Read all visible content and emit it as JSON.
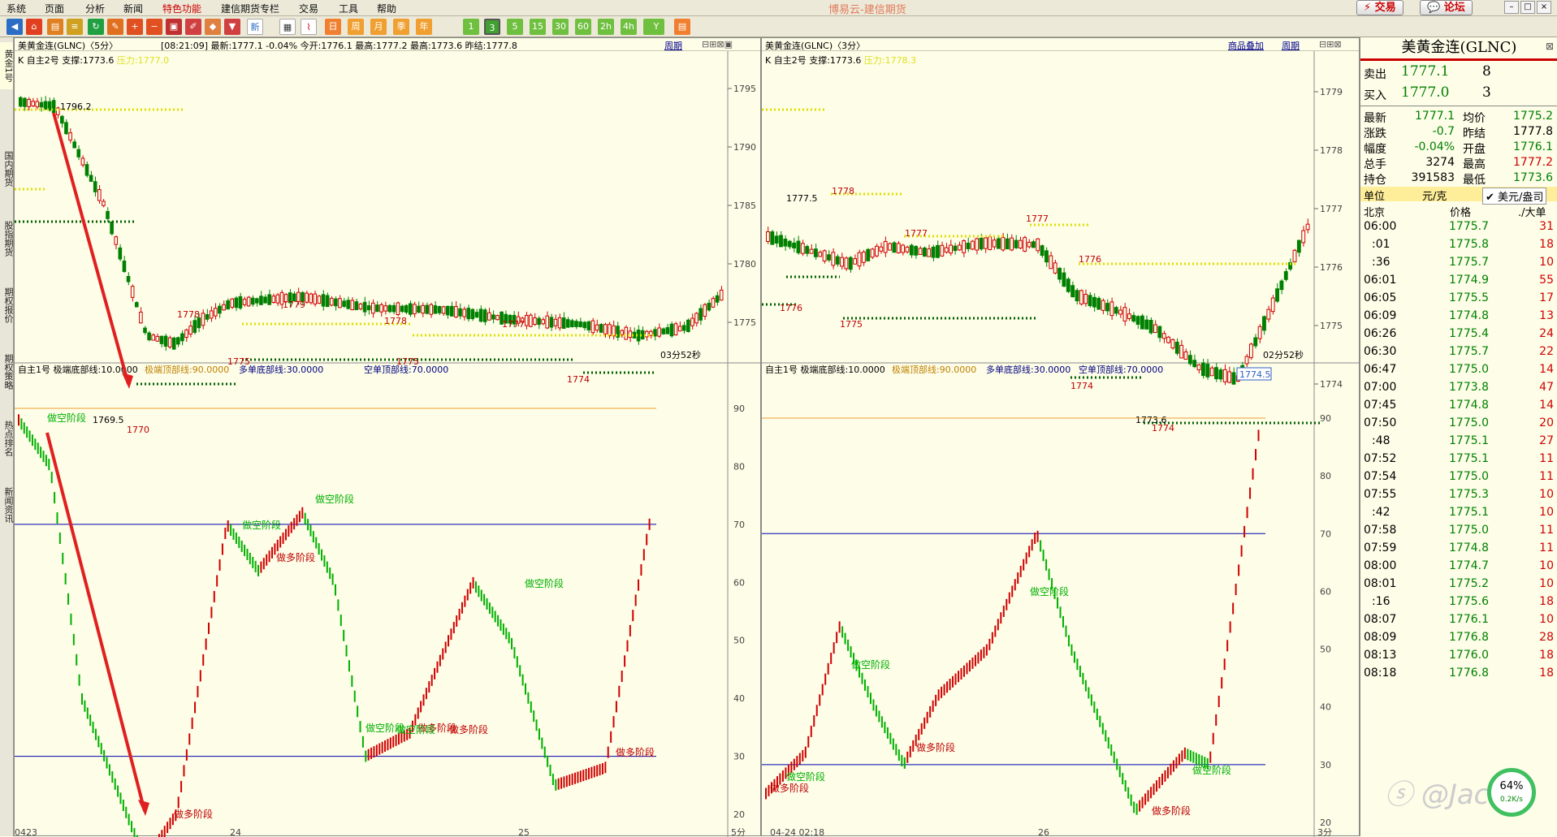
{
  "app": {
    "title": "博易云-建信期货",
    "menu": [
      "系统",
      "页面",
      "分析",
      "新闻",
      "特色功能",
      "建信期货专栏",
      "交易",
      "工具",
      "帮助"
    ],
    "trade_btn": "交易",
    "forum_btn": "论坛"
  },
  "toolbar": {
    "labels": [
      "新",
      "1",
      "3",
      "5",
      "15",
      "30",
      "60",
      "日",
      "周",
      "月",
      "季",
      "年",
      "Y"
    ]
  },
  "left_tabs": [
    "黄金1号",
    "国内期货",
    "股指期货",
    "期权报价",
    "期权策略",
    "热点排名",
    "新闻资讯"
  ],
  "left_chart": {
    "title": "美黄金连(GLNC)〈5分〉",
    "period": "周期",
    "info": "[08:21:09] 最新:1777.1 -0.04% 今开:1776.1 最高:1777.2 最高:1773.6 昨结:1777.8",
    "indicator": "K 自主2号 支撑:1773.6",
    "pressure": "压力:1777.0",
    "timer": "03分52秒",
    "yticks": [
      "1795",
      "1790",
      "1785",
      "1780",
      "1775"
    ],
    "labels": [
      "1796.2",
      "1769.5",
      "1770",
      "1778",
      "1779",
      "1778",
      "1777",
      "1775",
      "1775",
      "1774"
    ],
    "osc_title": "自主1号 极端底部线:10.0000",
    "osc_top": "极端顶部线:90.0000",
    "osc_mb": "多单底部线:30.0000",
    "osc_st": "空单顶部线:70.0000",
    "osc_yticks": [
      "90",
      "80",
      "70",
      "60",
      "50",
      "40",
      "30",
      "20"
    ],
    "stage_short": "做空阶段",
    "stage_long": "做多阶段",
    "xaxis": [
      "0423",
      "24",
      "25"
    ],
    "period_label": "5分"
  },
  "right_chart": {
    "title": "美黄金连(GLNC)〈3分〉",
    "overlay": "商品叠加",
    "period": "周期",
    "indicator": "K 自主2号 支撑:1773.6",
    "pressure": "压力:1778.3",
    "timer": "02分52秒",
    "yticks": [
      "1779",
      "1778",
      "1777",
      "1776",
      "1775",
      "1774"
    ],
    "labels": [
      "1777.5",
      "1778",
      "1776",
      "1775",
      "1777",
      "1777",
      "1776",
      "1774",
      "1773.6",
      "1774"
    ],
    "price_tag": "1774.5",
    "osc_title": "自主1号 极端底部线:10.0000",
    "osc_top": "极端顶部线:90.0000",
    "osc_mb": "多单底部线:30.0000",
    "osc_st": "空单顶部线:70.0000",
    "osc_yticks": [
      "90",
      "80",
      "70",
      "60",
      "50",
      "40",
      "30",
      "20"
    ],
    "stage_short": "做空阶段",
    "stage_long": "做多阶段",
    "xaxis": [
      "04-24 02:18",
      "26"
    ],
    "period_label": "3分"
  },
  "quote": {
    "title": "美黄金连(GLNC)",
    "sell_label": "卖出",
    "sell_price": "1777.1",
    "sell_vol": "8",
    "buy_label": "买入",
    "buy_price": "1777.0",
    "buy_vol": "3",
    "rows": [
      [
        "最新",
        "1777.1",
        "均价",
        "1775.2"
      ],
      [
        "涨跌",
        "-0.7",
        "昨结",
        "1777.8"
      ],
      [
        "幅度",
        "-0.04%",
        "开盘",
        "1776.1"
      ],
      [
        "总手",
        "3274",
        "最高",
        "1777.2"
      ],
      [
        "持仓",
        "391583",
        "最低",
        "1773.6"
      ]
    ],
    "unit_label": "单位",
    "unit_val": "元/克",
    "unit_sel": "美元/盎司",
    "tick_head": [
      "北京",
      "价格",
      "./大单"
    ],
    "ticks": [
      [
        "06:00",
        "1775.7",
        "31"
      ],
      [
        ":01",
        "1775.8",
        "18"
      ],
      [
        ":36",
        "1775.7",
        "10"
      ],
      [
        "06:01",
        "1774.9",
        "55"
      ],
      [
        "06:05",
        "1775.5",
        "17"
      ],
      [
        "06:09",
        "1774.8",
        "13"
      ],
      [
        "06:26",
        "1775.4",
        "24"
      ],
      [
        "06:30",
        "1775.7",
        "22"
      ],
      [
        "06:47",
        "1775.0",
        "14"
      ],
      [
        "07:00",
        "1773.8",
        "47"
      ],
      [
        "07:45",
        "1774.8",
        "14"
      ],
      [
        "07:50",
        "1775.0",
        "20"
      ],
      [
        ":48",
        "1775.1",
        "27"
      ],
      [
        "07:52",
        "1775.1",
        "11"
      ],
      [
        "07:54",
        "1775.0",
        "11"
      ],
      [
        "07:55",
        "1775.3",
        "10"
      ],
      [
        ":42",
        "1775.1",
        "10"
      ],
      [
        "07:58",
        "1775.0",
        "11"
      ],
      [
        "07:59",
        "1774.8",
        "11"
      ],
      [
        "08:00",
        "1774.7",
        "10"
      ],
      [
        "08:01",
        "1775.2",
        "10"
      ],
      [
        ":16",
        "1775.6",
        "18"
      ],
      [
        "08:07",
        "1776.1",
        "10"
      ],
      [
        "08:09",
        "1776.8",
        "28"
      ],
      [
        "08:13",
        "1776.0",
        "18"
      ],
      [
        "08:18",
        "1776.8",
        "18"
      ]
    ]
  },
  "watermark": "@Jac",
  "badge": {
    "pct": "64%",
    "speed": "0.2K/s"
  }
}
